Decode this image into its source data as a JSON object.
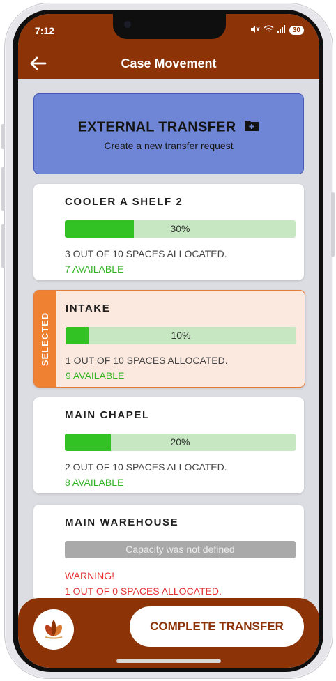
{
  "status": {
    "time": "7:12",
    "battery": "30"
  },
  "appbar": {
    "title": "Case Movement"
  },
  "external": {
    "title": "EXTERNAL TRANSFER",
    "subtitle": "Create a new transfer request"
  },
  "locations": [
    {
      "name": "COOLER A SHELF 2",
      "percent_label": "30%",
      "fill_fraction": 0.3,
      "allocated": "3 OUT OF 10 SPACES ALLOCATED.",
      "available": "7 AVAILABLE"
    },
    {
      "name": "INTAKE",
      "percent_label": "10%",
      "fill_fraction": 0.1,
      "allocated": "1 OUT OF 10 SPACES ALLOCATED.",
      "available": "9 AVAILABLE",
      "selected_label": "SELECTED"
    },
    {
      "name": "MAIN CHAPEL",
      "percent_label": "20%",
      "fill_fraction": 0.2,
      "allocated": "2 OUT OF 10 SPACES ALLOCATED.",
      "available": "8 AVAILABLE"
    },
    {
      "name": "MAIN WAREHOUSE",
      "capacity_note": "Capacity was not defined",
      "warning": "WARNING!",
      "allocated": "1 OUT OF 0 SPACES ALLOCATED."
    }
  ],
  "footer": {
    "complete_label": "COMPLETE TRANSFER"
  },
  "icons": {
    "back": "arrow-left-icon",
    "folder": "folder-add-icon",
    "logo": "leaf-logo-icon"
  },
  "colors": {
    "brand": "#8c3307",
    "external_card": "#6f86d6",
    "selected": "#ee8232",
    "progress": "#33c224",
    "available": "#32b324",
    "warning": "#e53030"
  }
}
